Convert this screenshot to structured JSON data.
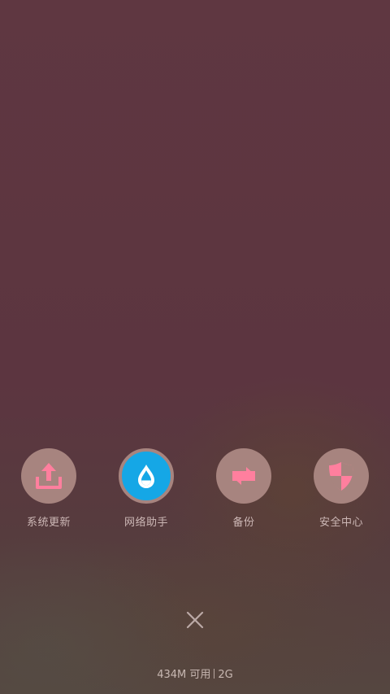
{
  "shortcuts": [
    {
      "label": "系统更新",
      "icon": "upload-icon",
      "active": false
    },
    {
      "label": "网络助手",
      "icon": "water-drop-icon",
      "active": true
    },
    {
      "label": "备份",
      "icon": "repeat-arrows-icon",
      "active": false
    },
    {
      "label": "安全中心",
      "icon": "shield-icon",
      "active": false
    }
  ],
  "close_icon": "close-icon",
  "status": {
    "memory": "434M 可用",
    "network": "2G"
  },
  "colors": {
    "icon_pink": "#ff7f9e",
    "circle_bg": "#a7847f",
    "active_bg": "#15a7e6"
  }
}
